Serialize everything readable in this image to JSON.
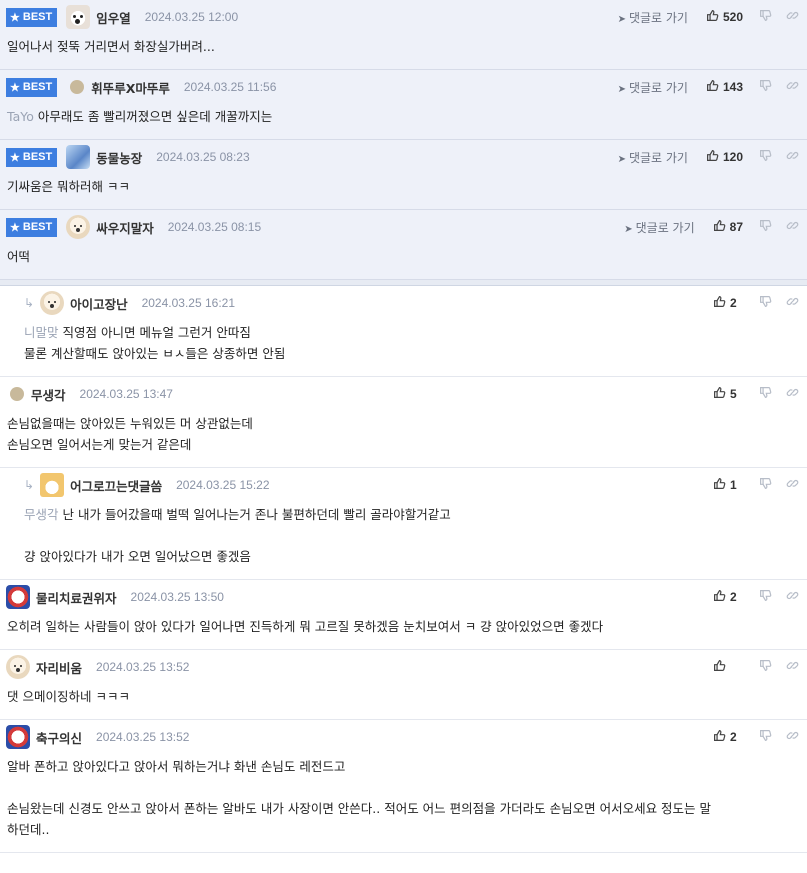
{
  "ui": {
    "best_label": "BEST",
    "goto_label": "댓글로 가기"
  },
  "best_comments": [
    {
      "avatar": "av-dog",
      "nick": "임우열",
      "date": "2024.03.25 12:00",
      "likes": "520",
      "lines": [
        "일어나서 젖뚝 거리면서 화장실가버려..."
      ]
    },
    {
      "avatar": "av-dot",
      "nick": "휘뚜루X마뚜루",
      "date": "2024.03.25 11:56",
      "likes": "143",
      "mention": "TaYo",
      "lines": [
        "아무래도 좀 빨리꺼졌으면 싶은데 개꿀까지는"
      ]
    },
    {
      "avatar": "av-blue",
      "nick": "동물농장",
      "date": "2024.03.25 08:23",
      "likes": "120",
      "lines": [
        "기싸움은 뭐하러해 ㅋㅋ"
      ]
    },
    {
      "avatar": "av-puppy",
      "nick": "싸우지말자",
      "date": "2024.03.25 08:15",
      "likes": "87",
      "lines": [
        "어떡"
      ]
    }
  ],
  "comments": [
    {
      "reply": true,
      "avatar": "av-puppy",
      "nick": "아이고장난",
      "date": "2024.03.25 16:21",
      "likes": "2",
      "mention": "니말맞",
      "lines": [
        "직영점 아니면 메뉴얼 그런거 안따짐",
        "물론 계산할때도 앉아있는 ㅂㅅ들은 상종하면 안됨"
      ]
    },
    {
      "reply": false,
      "avatar": "av-dot",
      "nick": "무생각",
      "date": "2024.03.25 13:47",
      "likes": "5",
      "lines": [
        "손님없을때는 앉아있든 누워있든 머 상관없는데",
        "손님오면 일어서는게 맞는거 같은데"
      ]
    },
    {
      "reply": true,
      "avatar": "av-corgi",
      "nick": "어그로끄는댓글씀",
      "date": "2024.03.25 15:22",
      "likes": "1",
      "mention": "무생각",
      "lines": [
        "난 내가 들어갔을때 벌떡 일어나는거 존나 불편하던데 빨리 골라야할거같고",
        "",
        "걍 앉아있다가 내가 오면 일어났으면 좋겠음"
      ]
    },
    {
      "reply": false,
      "avatar": "av-red",
      "nick": "물리치료권위자",
      "date": "2024.03.25 13:50",
      "likes": "2",
      "lines": [
        "오히려 일하는 사람들이 앉아 있다가 일어나면 진득하게 뭐 고르질 못하겠음 눈치보여서 ㅋ 걍 앉아있었으면 좋겠다"
      ]
    },
    {
      "reply": false,
      "avatar": "av-puppy",
      "nick": "자리비움",
      "date": "2024.03.25 13:52",
      "likes": "",
      "lines": [
        "댓 으메이징하네 ㅋㅋㅋ"
      ]
    },
    {
      "reply": false,
      "avatar": "av-red",
      "nick": "축구의신",
      "date": "2024.03.25 13:52",
      "likes": "2",
      "lines": [
        "알바 폰하고 앉아있다고 앉아서 뭐하는거냐 화낸 손님도 레전드고",
        "",
        "손님왔는데 신경도 안쓰고 앉아서 폰하는 알바도 내가 사장이면 안쓴다.. 적어도 어느 편의점을 가더라도 손님오면 어서오세요 정도는 말",
        "하던데.."
      ]
    }
  ],
  "icons": {
    "like": "thumbs-up-icon",
    "dislike": "thumbs-down-icon",
    "link": "link-icon",
    "goto": "send-arrow-icon",
    "star": "star-icon"
  }
}
